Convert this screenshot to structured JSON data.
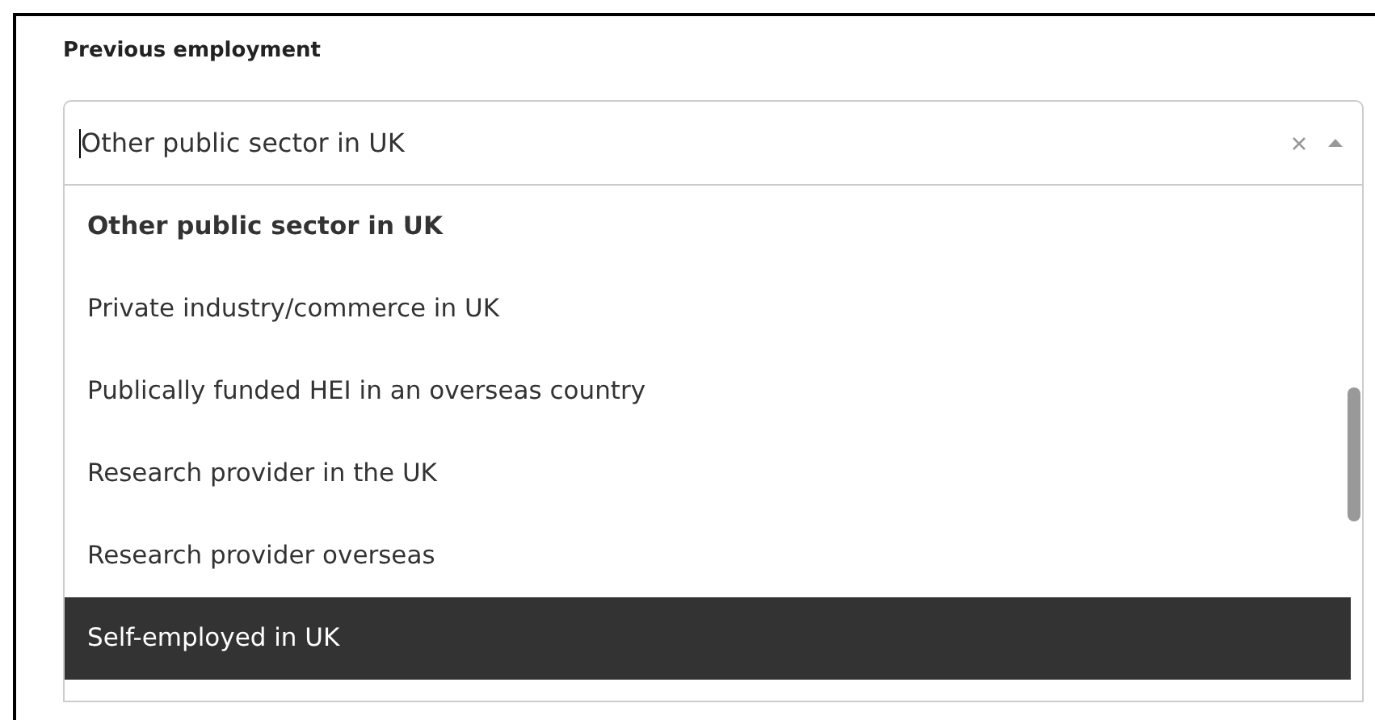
{
  "field": {
    "label": "Previous employment",
    "value": "Other public sector in UK",
    "expanded": true
  },
  "options": [
    {
      "label": "Other public sector in UK",
      "selected": true,
      "highlighted": false
    },
    {
      "label": "Private industry/commerce in UK",
      "selected": false,
      "highlighted": false
    },
    {
      "label": "Publically funded HEI in an overseas country",
      "selected": false,
      "highlighted": false
    },
    {
      "label": "Research provider in the UK",
      "selected": false,
      "highlighted": false
    },
    {
      "label": "Research provider overseas",
      "selected": false,
      "highlighted": false
    },
    {
      "label": "Self-employed in UK",
      "selected": false,
      "highlighted": true
    }
  ]
}
